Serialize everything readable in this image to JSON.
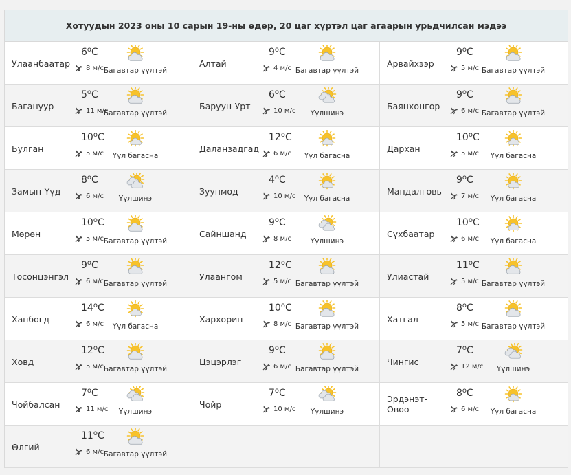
{
  "title": "Хотуудын 2023 оны 10 сарын 19-ны өдөр, 20 цаг хүртэл цаг агаарын урьдчилсан мэдээ",
  "temp_unit": "C",
  "colors": {
    "header_bg": "#e7eef0",
    "alt_row": "#f3f3f3",
    "sun": "#f7c22a",
    "cloud": "#e3e6ea"
  },
  "cities": [
    {
      "name": "Улаанбаатар",
      "temp": "6",
      "wind": "8 м/с",
      "cond": "Багавтар үүлтэй",
      "icon": "partly-cloudy-icon"
    },
    {
      "name": "Алтай",
      "temp": "9",
      "wind": "4 м/с",
      "cond": "Багавтар үүлтэй",
      "icon": "partly-cloudy-icon"
    },
    {
      "name": "Арвайхээр",
      "temp": "9",
      "wind": "5 м/с",
      "cond": "Багавтар үүлтэй",
      "icon": "partly-cloudy-icon"
    },
    {
      "name": "Багануур",
      "temp": "5",
      "wind": "11 м/с",
      "cond": "Багавтар үүлтэй",
      "icon": "partly-cloudy-icon"
    },
    {
      "name": "Баруун-Урт",
      "temp": "6",
      "wind": "10 м/с",
      "cond": "Үүлшинэ",
      "icon": "cloudy-icon"
    },
    {
      "name": "Баянхонгор",
      "temp": "9",
      "wind": "6 м/с",
      "cond": "Багавтар үүлтэй",
      "icon": "partly-cloudy-icon"
    },
    {
      "name": "Булган",
      "temp": "10",
      "wind": "5 м/с",
      "cond": "Үүл багасна",
      "icon": "mostly-sunny-icon"
    },
    {
      "name": "Даланзадгад",
      "temp": "12",
      "wind": "6 м/с",
      "cond": "Үүл багасна",
      "icon": "mostly-sunny-icon"
    },
    {
      "name": "Дархан",
      "temp": "10",
      "wind": "5 м/с",
      "cond": "Үүл багасна",
      "icon": "mostly-sunny-icon"
    },
    {
      "name": "Замын-Үүд",
      "temp": "8",
      "wind": "6 м/с",
      "cond": "Үүлшинэ",
      "icon": "cloudy-icon"
    },
    {
      "name": "Зуунмод",
      "temp": "4",
      "wind": "10 м/с",
      "cond": "Үүл багасна",
      "icon": "mostly-sunny-icon"
    },
    {
      "name": "Мандалговь",
      "temp": "9",
      "wind": "7 м/с",
      "cond": "Үүл багасна",
      "icon": "mostly-sunny-icon"
    },
    {
      "name": "Мөрөн",
      "temp": "10",
      "wind": "5 м/с",
      "cond": "Багавтар үүлтэй",
      "icon": "partly-cloudy-icon"
    },
    {
      "name": "Сайншанд",
      "temp": "9",
      "wind": "8 м/с",
      "cond": "Үүлшинэ",
      "icon": "cloudy-icon"
    },
    {
      "name": "Сүхбаатар",
      "temp": "10",
      "wind": "6 м/с",
      "cond": "Үүл багасна",
      "icon": "mostly-sunny-icon"
    },
    {
      "name": "Тосонцэнгэл",
      "temp": "9",
      "wind": "6 м/с",
      "cond": "Багавтар үүлтэй",
      "icon": "partly-cloudy-icon"
    },
    {
      "name": "Улаангом",
      "temp": "12",
      "wind": "5 м/с",
      "cond": "Багавтар үүлтэй",
      "icon": "partly-cloudy-icon"
    },
    {
      "name": "Улиастай",
      "temp": "11",
      "wind": "5 м/с",
      "cond": "Багавтар үүлтэй",
      "icon": "partly-cloudy-icon"
    },
    {
      "name": "Ханбогд",
      "temp": "14",
      "wind": "6 м/с",
      "cond": "Үүл багасна",
      "icon": "mostly-sunny-icon"
    },
    {
      "name": "Хархорин",
      "temp": "10",
      "wind": "8 м/с",
      "cond": "Багавтар үүлтэй",
      "icon": "partly-cloudy-icon"
    },
    {
      "name": "Хатгал",
      "temp": "8",
      "wind": "5 м/с",
      "cond": "Багавтар үүлтэй",
      "icon": "partly-cloudy-icon"
    },
    {
      "name": "Ховд",
      "temp": "12",
      "wind": "5 м/с",
      "cond": "Багавтар үүлтэй",
      "icon": "partly-cloudy-icon"
    },
    {
      "name": "Цэцэрлэг",
      "temp": "9",
      "wind": "6 м/с",
      "cond": "Багавтар үүлтэй",
      "icon": "partly-cloudy-icon"
    },
    {
      "name": "Чингис",
      "temp": "7",
      "wind": "12 м/с",
      "cond": "Үүлшинэ",
      "icon": "cloudy-icon"
    },
    {
      "name": "Чойбалсан",
      "temp": "7",
      "wind": "11 м/с",
      "cond": "Үүлшинэ",
      "icon": "cloudy-icon"
    },
    {
      "name": "Чойр",
      "temp": "7",
      "wind": "10 м/с",
      "cond": "Үүлшинэ",
      "icon": "cloudy-icon"
    },
    {
      "name": "Эрдэнэт-Овоо",
      "temp": "8",
      "wind": "6 м/с",
      "cond": "Үүл багасна",
      "icon": "mostly-sunny-icon"
    },
    {
      "name": "Өлгий",
      "temp": "11",
      "wind": "6 м/с",
      "cond": "Багавтар үүлтэй",
      "icon": "partly-cloudy-icon"
    }
  ]
}
